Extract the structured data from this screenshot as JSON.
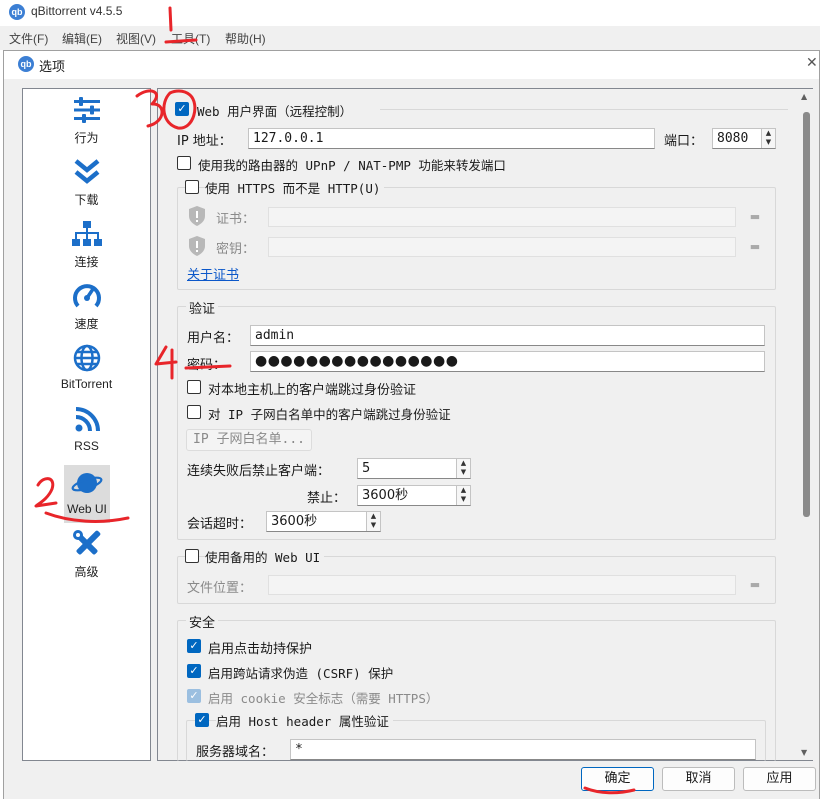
{
  "app": {
    "icon_text": "qb",
    "title": "qBittorrent v4.5.5"
  },
  "menubar": {
    "items": [
      "文件(F)",
      "编辑(E)",
      "视图(V)",
      "工具(T)",
      "帮助(H)"
    ]
  },
  "dialog": {
    "icon_text": "qb",
    "title": "选项",
    "close_glyph": "✕"
  },
  "sidebar": {
    "items": [
      {
        "label": "行为",
        "icon": "sliders-icon"
      },
      {
        "label": "下载",
        "icon": "download-chevrons-icon"
      },
      {
        "label": "连接",
        "icon": "network-icon"
      },
      {
        "label": "速度",
        "icon": "speedometer-icon"
      },
      {
        "label": "BitTorrent",
        "icon": "globe-icon"
      },
      {
        "label": "RSS",
        "icon": "rss-icon"
      },
      {
        "label": "Web UI",
        "icon": "planet-icon",
        "selected": true
      },
      {
        "label": "高级",
        "icon": "tools-icon"
      }
    ]
  },
  "webui": {
    "enable_label": "Web 用户界面（远程控制）",
    "enable_checked": true,
    "ip_label": "IP 地址：",
    "ip_value": "127.0.0.1",
    "port_label": "端口：",
    "port_value": "8080",
    "upnp_label": "使用我的路由器的 UPnP / NAT-PMP 功能来转发端口",
    "https_label": "使用 HTTPS 而不是 HTTP(U)",
    "cert_label": "证书：",
    "key_label": "密钥：",
    "cert_link": "关于证书"
  },
  "auth": {
    "title": "验证",
    "username_label": "用户名：",
    "username_value": "admin",
    "password_label": "密码：",
    "password_value": "●●●●●●●●●●●●●●●●",
    "bypass_local_label": "对本地主机上的客户端跳过身份验证",
    "bypass_subnet_label": "对 IP 子网白名单中的客户端跳过身份验证",
    "whitelist_button": "IP 子网白名单...",
    "ban_after_label": "连续失败后禁止客户端：",
    "ban_after_value": "5",
    "ban_duration_label": "禁止：",
    "ban_duration_value": "3600秒",
    "session_timeout_label": "会话超时：",
    "session_timeout_value": "3600秒"
  },
  "alt_ui": {
    "label": "使用备用的 Web UI",
    "location_label": "文件位置："
  },
  "security": {
    "title": "安全",
    "clickjacking_label": "启用点击劫持保护",
    "csrf_label": "启用跨站请求伪造 (CSRF) 保护",
    "cookie_label": "启用 cookie 安全标志（需要 HTTPS）",
    "host_header_label": "启用 Host header 属性验证",
    "server_domains_label": "服务器域名：",
    "server_domains_value": "*"
  },
  "footer": {
    "ok": "确定",
    "cancel": "取消",
    "apply": "应用"
  },
  "annotations": {
    "n1": "1",
    "n2": "2",
    "n3": "3",
    "n4": "4"
  },
  "colors": {
    "accent": "#0067c0",
    "icon_blue": "#1c6fc9",
    "annotation_red": "#e8252a"
  }
}
